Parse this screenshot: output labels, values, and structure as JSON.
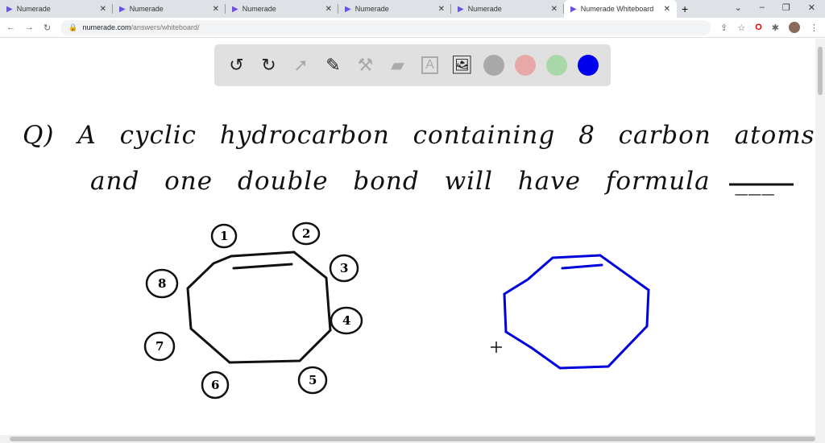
{
  "browser": {
    "tabs": [
      {
        "label": "Numerade"
      },
      {
        "label": "Numerade"
      },
      {
        "label": "Numerade"
      },
      {
        "label": "Numerade"
      },
      {
        "label": "Numerade"
      },
      {
        "label": "Numerade Whiteboard",
        "active": true
      }
    ],
    "url_host": "numerade.com",
    "url_path": "/answers/whiteboard/"
  },
  "toolbar": {
    "tools": [
      "undo-icon",
      "redo-icon",
      "pointer-icon",
      "pen-icon",
      "tools-icon",
      "eraser-icon",
      "text-icon",
      "image-icon"
    ],
    "colors": [
      "#a9a9a9",
      "#e8a8a8",
      "#a8d8a8",
      "#0000ee"
    ]
  },
  "board": {
    "line1": "Q) A cyclic hydrocarbon containing 8 carbon atoms",
    "line2": "and one double bond will have formula ___",
    "labels": [
      "1",
      "2",
      "3",
      "4",
      "5",
      "6",
      "7",
      "8"
    ]
  }
}
